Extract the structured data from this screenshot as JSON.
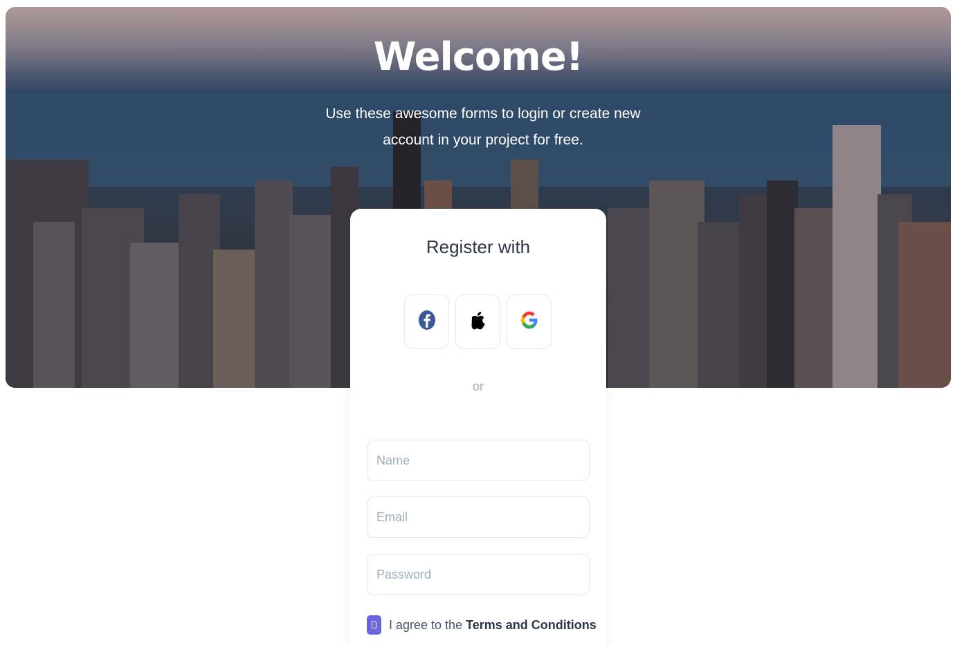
{
  "hero": {
    "title": "Welcome!",
    "subtitle": "Use these awesome forms to login or create new account in your project for free."
  },
  "card": {
    "title": "Register with",
    "social": [
      {
        "icon": "facebook-icon"
      },
      {
        "icon": "apple-icon"
      },
      {
        "icon": "google-icon"
      }
    ],
    "divider": "or",
    "fields": {
      "name_placeholder": "Name",
      "email_placeholder": "Email",
      "password_placeholder": "Password"
    },
    "agree": {
      "prefix": "I agree to the",
      "link": "Terms and Conditions"
    }
  },
  "colors": {
    "accent": "#6c63e0",
    "facebook": "#3b5998"
  }
}
